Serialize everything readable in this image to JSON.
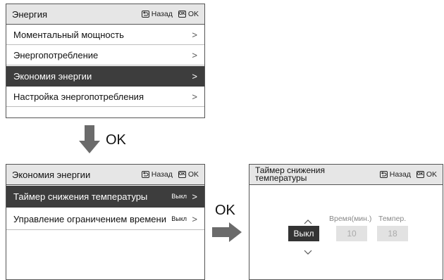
{
  "panel1": {
    "title": "Энергия",
    "back_label": "Назад",
    "ok_label": "OK",
    "ok_icon_text": "OK",
    "items": [
      {
        "label": "Моментальный мощность"
      },
      {
        "label": "Энергопотребление"
      },
      {
        "label": "Экономия энергии",
        "selected": true
      },
      {
        "label": "Настройка энергопотребления"
      }
    ],
    "chevron": ">"
  },
  "arrow_down_label": "OK",
  "panel2": {
    "title": "Экономия энергии",
    "back_label": "Назад",
    "ok_label": "OK",
    "ok_icon_text": "OK",
    "items": [
      {
        "label": "Таймер снижения температуры",
        "value": "Выкл",
        "selected": true
      },
      {
        "label": "Управление ограничением времени",
        "value": "Выкл"
      }
    ],
    "chevron": ">"
  },
  "arrow_right_label": "OK",
  "panel3": {
    "title_line1": "Таймер снижения",
    "title_line2": "температуры",
    "back_label": "Назад",
    "ok_label": "OK",
    "ok_icon_text": "OK",
    "time_label": "Время(мин.)",
    "temp_label": "Темпер.",
    "mode_value": "Выкл",
    "time_value": "10",
    "temp_value": "18"
  },
  "colors": {
    "selected_bg": "#3d3d3d",
    "header_bg": "#e6e6e6",
    "arrow": "#6b6b6b"
  }
}
